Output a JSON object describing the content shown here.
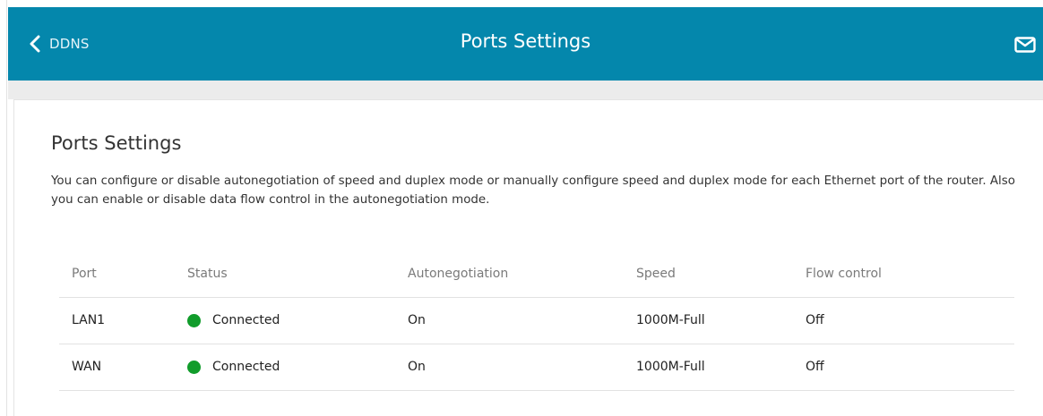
{
  "header": {
    "back_label": "DDNS",
    "title": "Ports Settings"
  },
  "content": {
    "title": "Ports Settings",
    "description": "You can configure or disable autonegotiation of speed and duplex mode or manually configure speed and duplex mode for each Ethernet port of the router. Also you can enable or disable data flow control in the autonegotiation mode."
  },
  "table": {
    "columns": [
      "Port",
      "Status",
      "Autonegotiation",
      "Speed",
      "Flow control"
    ],
    "rows": [
      {
        "port": "LAN1",
        "status": "Connected",
        "autonegotiation": "On",
        "speed": "1000M-Full",
        "flow_control": "Off"
      },
      {
        "port": "WAN",
        "status": "Connected",
        "autonegotiation": "On",
        "speed": "1000M-Full",
        "flow_control": "Off"
      }
    ]
  },
  "colors": {
    "header_bg": "#0487ac",
    "status_connected": "#119c2b"
  },
  "icons": {
    "back": "chevron-left-icon",
    "mail": "mail-icon",
    "status": "status-dot-icon"
  }
}
